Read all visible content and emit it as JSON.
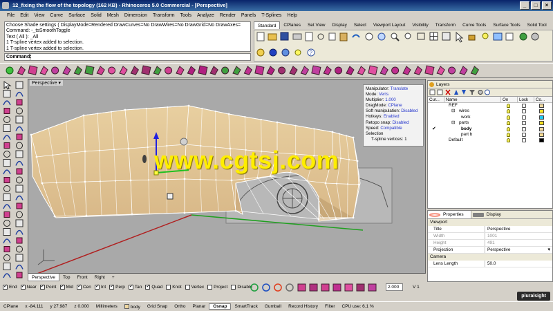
{
  "window": {
    "title": "12_fixing the flow of the topology (162 KB) - Rhinoceros 5.0 Commercial - [Perspective]"
  },
  "menu": [
    "File",
    "Edit",
    "View",
    "Curve",
    "Surface",
    "Solid",
    "Mesh",
    "Dimension",
    "Transform",
    "Tools",
    "Analyze",
    "Render",
    "Panels",
    "T-Splines",
    "Help"
  ],
  "command": {
    "history": [
      "Choose Shade settings ( DisplayMode=Rendered  DrawCurves=No  DrawWires=No  DrawGrid=No  DrawAxes=",
      "Command: -_tsSmoothToggle",
      "Text ( All ): _All",
      "1 T-spline vertex added to selection.",
      "1 T-spline vertex added to selection."
    ],
    "prompt_label": "Command:"
  },
  "toolbar_tabs": [
    "Standard",
    "CPlanes",
    "Set View",
    "Display",
    "Select",
    "Viewport Layout",
    "Visibility",
    "Transform",
    "Curve Tools",
    "Surface Tools",
    "Solid Tool"
  ],
  "active_toolbar_tab": "Standard",
  "viewport": {
    "title": "Perspective",
    "info": {
      "manipulator_label": "Manipulator:",
      "manipulator_value": "Translate",
      "mode_label": "Mode:",
      "mode_value": "Verts",
      "multiplier_label": "Multiplier:",
      "multiplier_value": "1.000",
      "dragmode_label": "DragMode:",
      "dragmode_value": "CPlane",
      "softmanip_label": "Soft manipulation:",
      "softmanip_value": "Disabled",
      "hotkeys_label": "Hotkeys:",
      "hotkeys_value": "Enabled",
      "retopo_label": "Retopo snap:",
      "retopo_value": "Disabled",
      "speed_label": "Speed:",
      "speed_value": "Compatible",
      "selection_label": "Selection",
      "tspline_label": "T-spline vertices:",
      "tspline_value": "1"
    },
    "watermark": "www.cgtsj.com"
  },
  "viewport_tabs": [
    "Perspective",
    "Top",
    "Front",
    "Right"
  ],
  "osnap": [
    {
      "label": "End",
      "checked": true
    },
    {
      "label": "Near",
      "checked": true
    },
    {
      "label": "Point",
      "checked": true
    },
    {
      "label": "Mid",
      "checked": true
    },
    {
      "label": "Cen",
      "checked": true
    },
    {
      "label": "Int",
      "checked": true
    },
    {
      "label": "Perp",
      "checked": true
    },
    {
      "label": "Tan",
      "checked": true
    },
    {
      "label": "Quad",
      "checked": true
    },
    {
      "label": "Knot",
      "checked": false
    },
    {
      "label": "Vertex",
      "checked": false
    },
    {
      "label": "Project",
      "checked": false
    },
    {
      "label": "Disable",
      "checked": false
    }
  ],
  "bottom_toolbar": {
    "zoom_value": "2.000",
    "version_label": "V 1"
  },
  "status": {
    "cplane": "CPlane",
    "x": "x -84.111",
    "y": "y 27.987",
    "z": "z 0.000",
    "units": "Millimeters",
    "layer": "body",
    "grid_snap": "Grid Snap",
    "ortho": "Ortho",
    "planar": "Planar",
    "osnap": "Osnap",
    "smarttrack": "SmartTrack",
    "gumball": "Gumball",
    "record_history": "Record History",
    "filter": "Filter",
    "cpu": "CPU use: 6.1 %"
  },
  "brand": "pluralsight",
  "layers_panel": {
    "tab": "Layers",
    "columns": [
      "Cur...",
      "Name",
      "On",
      "Lock",
      "Co..."
    ],
    "rows": [
      {
        "name": "REF",
        "indent": 0,
        "current": false,
        "color": "#f0d8a0"
      },
      {
        "name": "wires",
        "indent": 1,
        "current": false,
        "color": "#f8e020",
        "expander": "⊟"
      },
      {
        "name": "work",
        "indent": 2,
        "current": false,
        "color": "#20c8f0"
      },
      {
        "name": "parts",
        "indent": 1,
        "current": false,
        "color": "#f8e020",
        "expander": "⊟"
      },
      {
        "name": "body",
        "indent": 2,
        "current": true,
        "color": "#f0d8a0"
      },
      {
        "name": "part b",
        "indent": 2,
        "current": false,
        "color": "#f8d890"
      },
      {
        "name": "Default",
        "indent": 0,
        "current": false,
        "color": "#000000"
      }
    ]
  },
  "properties_panel": {
    "tabs": [
      "Properties",
      "Display"
    ],
    "sections": {
      "viewport": "Viewport",
      "camera": "Camera"
    },
    "rows": [
      {
        "key": "Title",
        "value": "Perspective",
        "dim": false
      },
      {
        "key": "Width",
        "value": "1001",
        "dim": true
      },
      {
        "key": "Height",
        "value": "491",
        "dim": true
      },
      {
        "key": "Projection",
        "value": "Perspective",
        "dim": false,
        "dropdown": true
      }
    ],
    "camera_rows": [
      {
        "key": "Lens Length",
        "value": "50.0"
      }
    ]
  }
}
